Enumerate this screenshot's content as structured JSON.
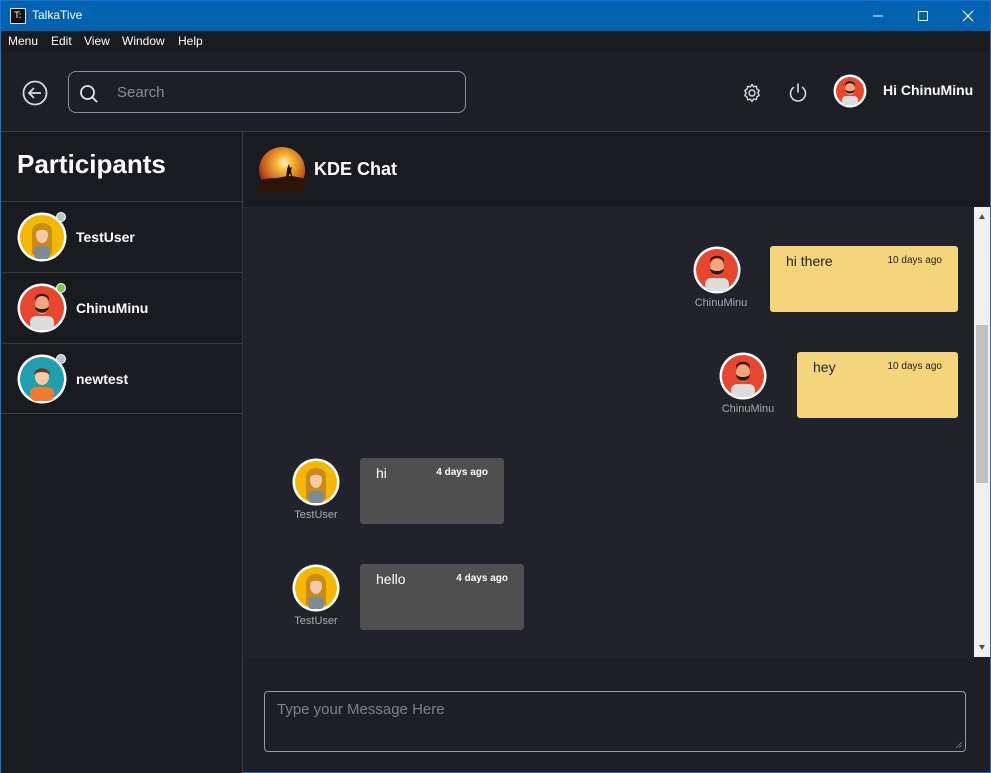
{
  "window": {
    "title": "TalkaTive",
    "app_icon_glyph": "T:"
  },
  "menu": [
    "Menu",
    "Edit",
    "View",
    "Window",
    "Help"
  ],
  "header": {
    "search_placeholder": "Search",
    "greeting": "Hi ChinuMinu"
  },
  "sidebar": {
    "title": "Participants",
    "participants": [
      {
        "name": "TestUser",
        "status_color": "#b8c2cc",
        "avatar": "female-yellow-avatar"
      },
      {
        "name": "ChinuMinu",
        "status_color": "#8bc34a",
        "avatar": "male-red-avatar"
      },
      {
        "name": "newtest",
        "status_color": "#b8c2cc",
        "avatar": "male-teal-avatar"
      }
    ]
  },
  "chat": {
    "title": "KDE Chat",
    "messages": [
      {
        "sender": "ChinuMinu",
        "text": "hi there",
        "time": "10 days ago",
        "mine": true
      },
      {
        "sender": "ChinuMinu",
        "text": "hey",
        "time": "10 days ago",
        "mine": true
      },
      {
        "sender": "TestUser",
        "text": "hi",
        "time": "4 days ago",
        "mine": false
      },
      {
        "sender": "TestUser",
        "text": "hello",
        "time": "4 days ago",
        "mine": false
      }
    ],
    "composer_placeholder": "Type your Message Here"
  },
  "colors": {
    "titlebar": "#0063b1",
    "my_bubble": "#f5d57b",
    "other_bubble": "#4f4f4f",
    "online": "#8bc34a"
  }
}
